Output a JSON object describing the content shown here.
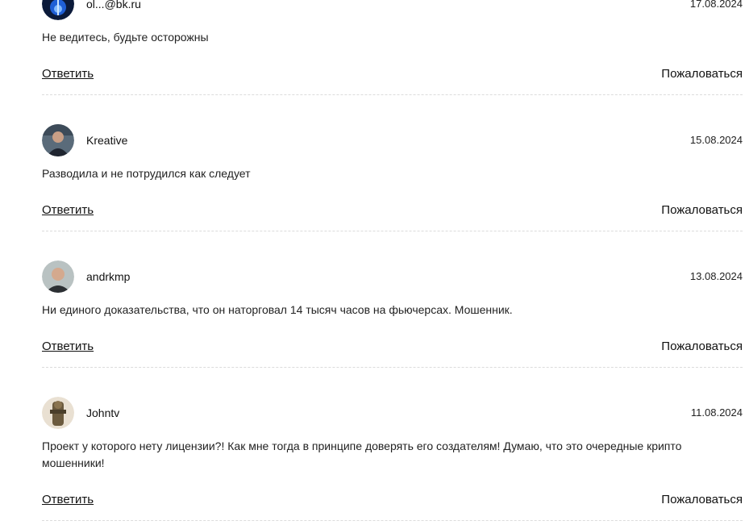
{
  "comments": [
    {
      "author": "ol...@bk.ru",
      "date": "17.08.2024",
      "text": "Не ведитесь, будьте осторожны",
      "avatar_icon": "blue-light-avatar"
    },
    {
      "author": "Kreative",
      "date": "15.08.2024",
      "text": "Разводила и не потрудился как следует",
      "avatar_icon": "man-portrait-avatar"
    },
    {
      "author": "andrkmp",
      "date": "13.08.2024",
      "text": "Ни единого доказательства, что он наторговал 14 тысяч часов на фьючерсах. Мошенник.",
      "avatar_icon": "man-portrait-avatar"
    },
    {
      "author": "Johntv",
      "date": "11.08.2024",
      "text": "Проект у которого нету лицензии?! Как мне тогда в принципе доверять его создателям! Думаю, что это очередные крипто мошенники!",
      "avatar_icon": "figure-avatar"
    }
  ],
  "actions": {
    "reply_label": "Ответить",
    "report_label": "Пожаловаться"
  }
}
